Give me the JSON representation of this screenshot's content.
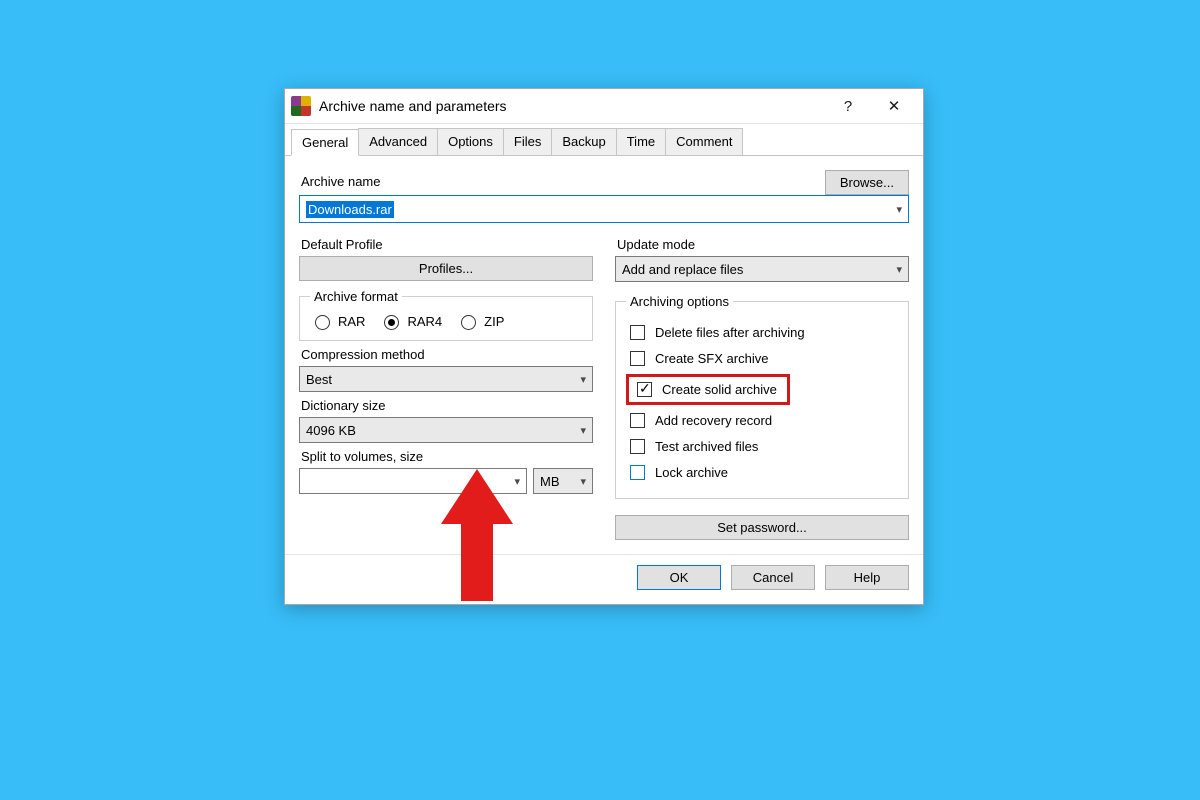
{
  "title": "Archive name and parameters",
  "tabs": [
    "General",
    "Advanced",
    "Options",
    "Files",
    "Backup",
    "Time",
    "Comment"
  ],
  "active_tab": 0,
  "archive_name_label": "Archive name",
  "browse_label": "Browse...",
  "archive_name_value": "Downloads.rar",
  "default_profile_label": "Default Profile",
  "profiles_button": "Profiles...",
  "update_mode_label": "Update mode",
  "update_mode_value": "Add and replace files",
  "archive_format_legend": "Archive format",
  "formats": {
    "rar": "RAR",
    "rar4": "RAR4",
    "zip": "ZIP"
  },
  "format_selected": "rar4",
  "compression_label": "Compression method",
  "compression_value": "Best",
  "dictionary_label": "Dictionary size",
  "dictionary_value": "4096 KB",
  "split_label": "Split to volumes, size",
  "split_value": "",
  "split_unit": "MB",
  "archiving_options_legend": "Archiving options",
  "opts": {
    "delete_after": "Delete files after archiving",
    "sfx": "Create SFX archive",
    "solid": "Create solid archive",
    "recovery": "Add recovery record",
    "test": "Test archived files",
    "lock": "Lock archive"
  },
  "set_password": "Set password...",
  "ok": "OK",
  "cancel": "Cancel",
  "help": "Help"
}
